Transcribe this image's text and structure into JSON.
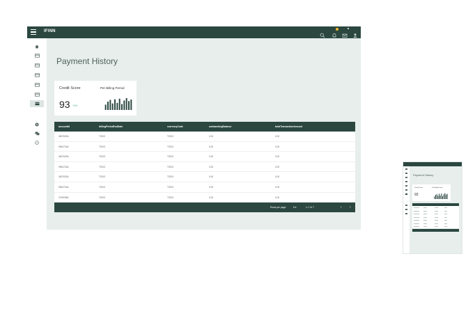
{
  "header": {
    "menu_icon": "menu-icon",
    "app_name": "IFINN",
    "icons": [
      "search-icon",
      "notifications-icon",
      "mail-icon",
      "account-icon"
    ]
  },
  "sidebar": {
    "items": [
      {
        "icon": "home-icon"
      },
      {
        "icon": "card-icon"
      },
      {
        "icon": "card-icon"
      },
      {
        "icon": "card-icon"
      },
      {
        "icon": "card-icon"
      },
      {
        "icon": "card-icon"
      },
      {
        "icon": "card-icon",
        "active": true
      },
      {
        "icon": "settings-icon"
      },
      {
        "icon": "chat-icon"
      },
      {
        "icon": "help-icon"
      }
    ]
  },
  "page": {
    "title": "Payment History"
  },
  "score_card": {
    "credit_label": "Credit Score",
    "score": "93",
    "change": "+2%",
    "period_label": "Per Billing Period",
    "bars": [
      0.45,
      0.7,
      0.85,
      0.55,
      0.9,
      0.6,
      0.95,
      0.5,
      0.8,
      1.0,
      0.75,
      0.88
    ]
  },
  "table": {
    "columns": [
      "accountId",
      "billingPeriodEndDate",
      "currencyCode",
      "outstandingBalance",
      "totalTransactionAmount"
    ],
    "rows": [
      [
        "4837629A",
        "TODO",
        "TODO",
        "0.00",
        "0.00"
      ],
      [
        "9964716A",
        "TODO",
        "TODO",
        "0.00",
        "0.00"
      ],
      [
        "4837629A",
        "TODO",
        "TODO",
        "0.00",
        "0.00"
      ],
      [
        "9964716A",
        "TODO",
        "TODO",
        "0.00",
        "0.00"
      ],
      [
        "4837629A",
        "TODO",
        "TODO",
        "0.00",
        "0.00"
      ],
      [
        "9964716A",
        "TODO",
        "TODO",
        "0.00",
        "0.00"
      ],
      [
        "3749036D",
        "TODO",
        "TODO",
        "0.00",
        "0.00"
      ]
    ],
    "footer": {
      "rows_per_page_label": "Rows per page:",
      "rows_per_page_value": "8 ▾",
      "range_text": "1–7 of 7"
    }
  },
  "colors": {
    "primary": "#2b4740",
    "background": "#e7eeec",
    "accent": "#f5b82e",
    "positive": "#3cab80"
  }
}
